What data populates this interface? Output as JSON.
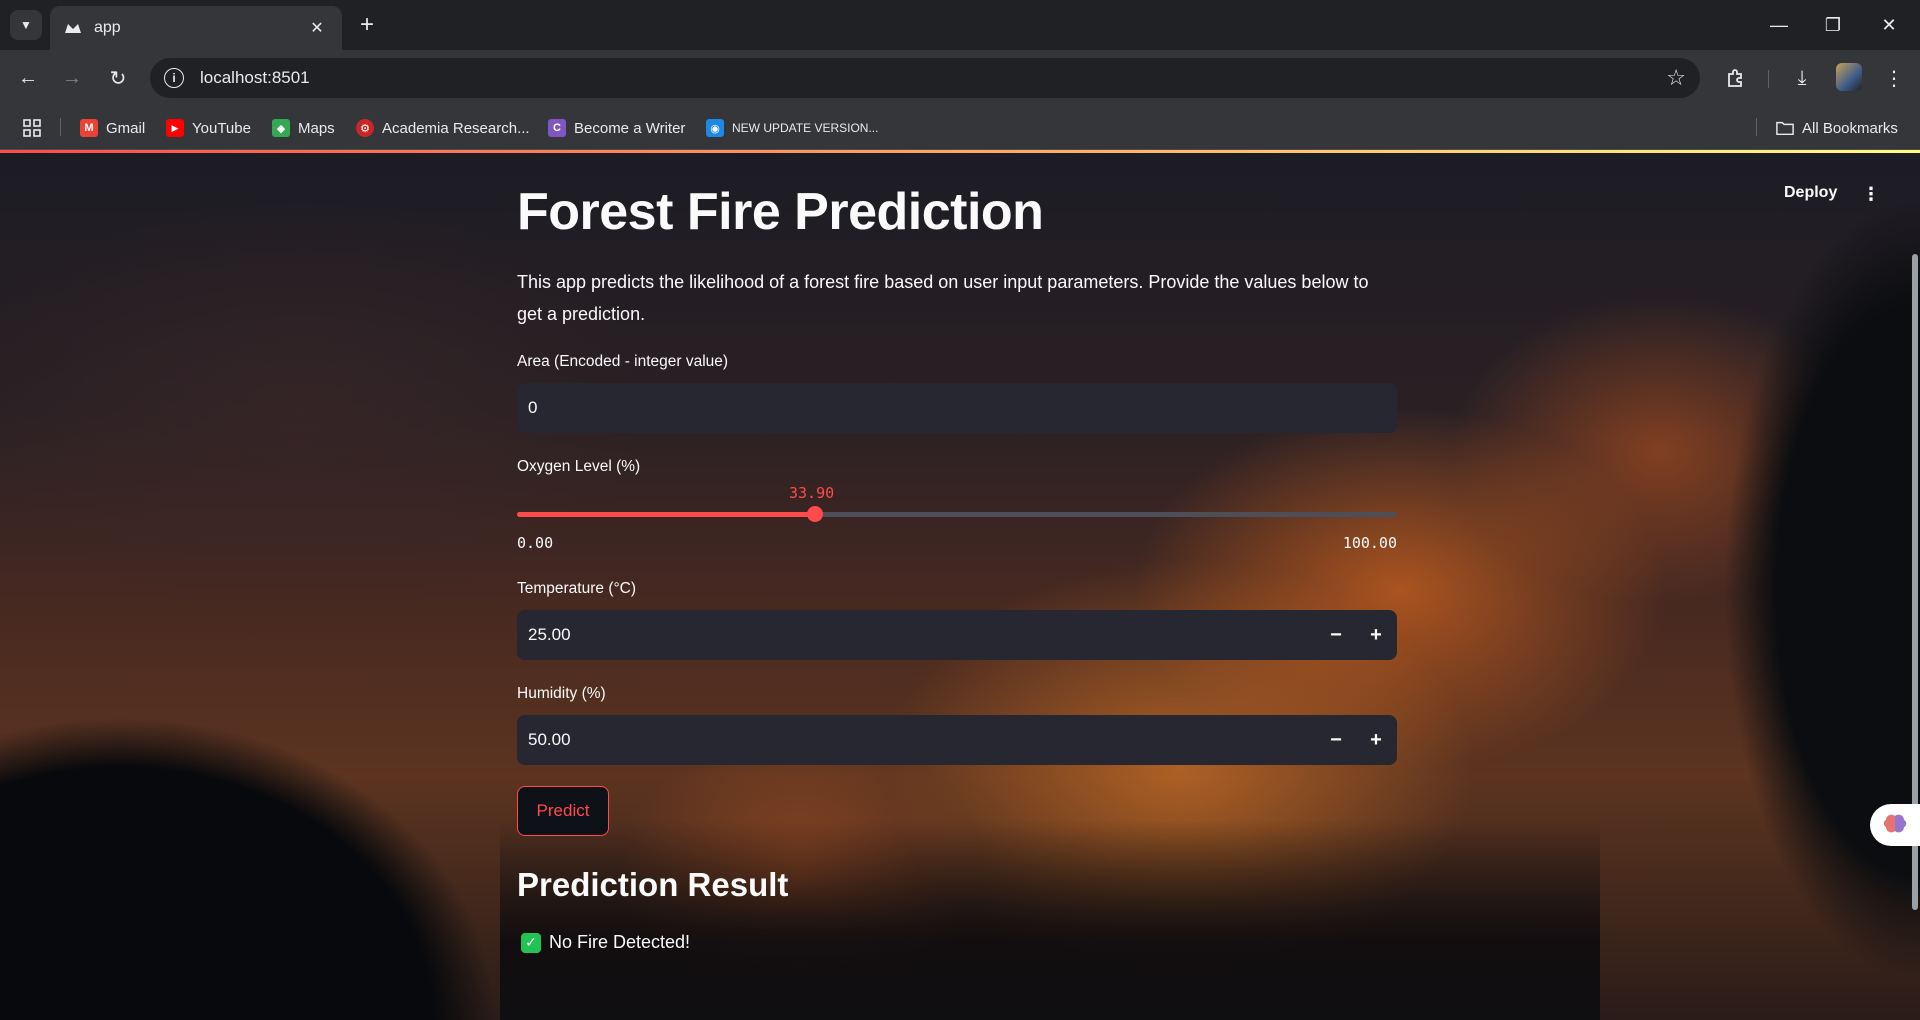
{
  "browser": {
    "tab_title": "app",
    "url": "localhost:8501",
    "bookmarks": [
      {
        "label": "Gmail",
        "icon": "gmail-icon",
        "color": "#ea4335",
        "glyph": "M"
      },
      {
        "label": "YouTube",
        "icon": "youtube-icon",
        "color": "#ff0000",
        "glyph": "▶"
      },
      {
        "label": "Maps",
        "icon": "maps-icon",
        "color": "#34a853",
        "glyph": "◆"
      },
      {
        "label": "Academia Research...",
        "icon": "academia-icon",
        "color": "#c62828",
        "glyph": "⚙"
      },
      {
        "label": "Become a Writer",
        "icon": "writer-icon",
        "color": "#7e57c2",
        "glyph": "C"
      },
      {
        "label": "NEW UPDATE VERSION...",
        "icon": "update-icon",
        "color": "#1e88e5",
        "glyph": "◉"
      }
    ],
    "all_bookmarks": "All Bookmarks"
  },
  "app": {
    "deploy": "Deploy",
    "menu": "⋮",
    "title": "Forest Fire Prediction",
    "description": "This app predicts the likelihood of a forest fire based on user input parameters. Provide the values below to get a prediction.",
    "area": {
      "label": "Area (Encoded - integer value)",
      "value": "0"
    },
    "oxygen": {
      "label": "Oxygen Level (%)",
      "value": "33.90",
      "min": "0.00",
      "max": "100.00",
      "fraction": 0.339
    },
    "temperature": {
      "label": "Temperature (°C)",
      "value": "25.00"
    },
    "humidity": {
      "label": "Humidity (%)",
      "value": "50.00"
    },
    "predict_label": "Predict",
    "result_heading": "Prediction Result",
    "result_text": "No Fire Detected!",
    "accent_color": "#ff4b4b",
    "success_color": "#21c354"
  }
}
